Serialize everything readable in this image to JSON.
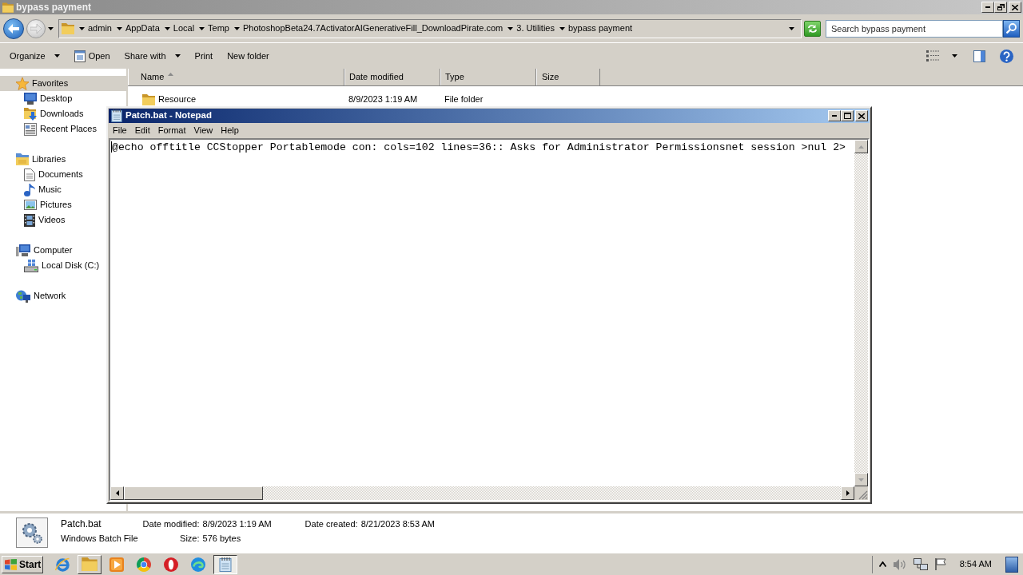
{
  "explorer": {
    "title": "bypass payment",
    "navigation": {
      "back_disabled": false,
      "forward_disabled": true
    },
    "breadcrumbs": [
      "admin",
      "AppData",
      "Local",
      "Temp",
      "PhotoshopBeta24.7ActivatorAIGenerativeFill_DownloadPirate.com",
      "3. Utilities",
      "bypass payment"
    ],
    "search": {
      "placeholder": "Search bypass payment"
    },
    "toolbar": [
      {
        "label": "Organize",
        "kind": "dropdown"
      },
      {
        "label": "Open",
        "kind": "icon"
      },
      {
        "label": "Share with",
        "kind": "dropdown"
      },
      {
        "label": "Print",
        "kind": "plain"
      },
      {
        "label": "New folder",
        "kind": "plain"
      }
    ]
  },
  "sidebar": [
    {
      "label": "Favorites",
      "selected": true,
      "children": [
        {
          "label": "Desktop",
          "selected": false
        },
        {
          "label": "Downloads",
          "selected": false
        },
        {
          "label": "Recent Places",
          "selected": false
        }
      ]
    },
    {
      "label": "Libraries",
      "selected": false,
      "children": [
        {
          "label": "Documents",
          "selected": false
        },
        {
          "label": "Music",
          "selected": false
        },
        {
          "label": "Pictures",
          "selected": false
        },
        {
          "label": "Videos",
          "selected": false
        }
      ]
    },
    {
      "label": "Computer",
      "selected": false,
      "children": [
        {
          "label": "Local Disk (C:)",
          "selected": false
        }
      ]
    },
    {
      "label": "Network",
      "selected": false
    }
  ],
  "file_list": {
    "columns": [
      {
        "label": "Name",
        "sorted": true
      },
      {
        "label": "Date modified",
        "sorted": false
      },
      {
        "label": "Type",
        "sorted": false
      },
      {
        "label": "Size",
        "sorted": false
      }
    ],
    "rows": [
      {
        "name": "Resource",
        "date_modified": "8/9/2023 1:19 AM",
        "type": "File folder"
      }
    ]
  },
  "details": {
    "name": "Patch.bat",
    "type": "Windows Batch File",
    "columns": [
      [
        {
          "label": "Date modified:",
          "value": "8/9/2023 1:19 AM"
        },
        {
          "label": "Size:",
          "value": "576 bytes"
        }
      ],
      [
        {
          "label": "Date created:",
          "value": "8/21/2023 8:53 AM"
        }
      ]
    ]
  },
  "notepad": {
    "title": "Patch.bat - Notepad",
    "menu": [
      "File",
      "Edit",
      "Format",
      "View",
      "Help"
    ],
    "text": "@echo offtitle CCStopper Portablemode con: cols=102 lines=36:: Asks for Administrator Permissionsnet session >nul 2>"
  },
  "taskbar": {
    "start": "Start",
    "apps": [
      {
        "running": false,
        "active": false
      },
      {
        "running": true,
        "active": false
      },
      {
        "running": false,
        "active": false
      },
      {
        "running": false,
        "active": false
      },
      {
        "running": false,
        "active": false
      },
      {
        "running": false,
        "active": false
      },
      {
        "running": true,
        "active": true
      }
    ],
    "clock": "8:54 AM"
  }
}
